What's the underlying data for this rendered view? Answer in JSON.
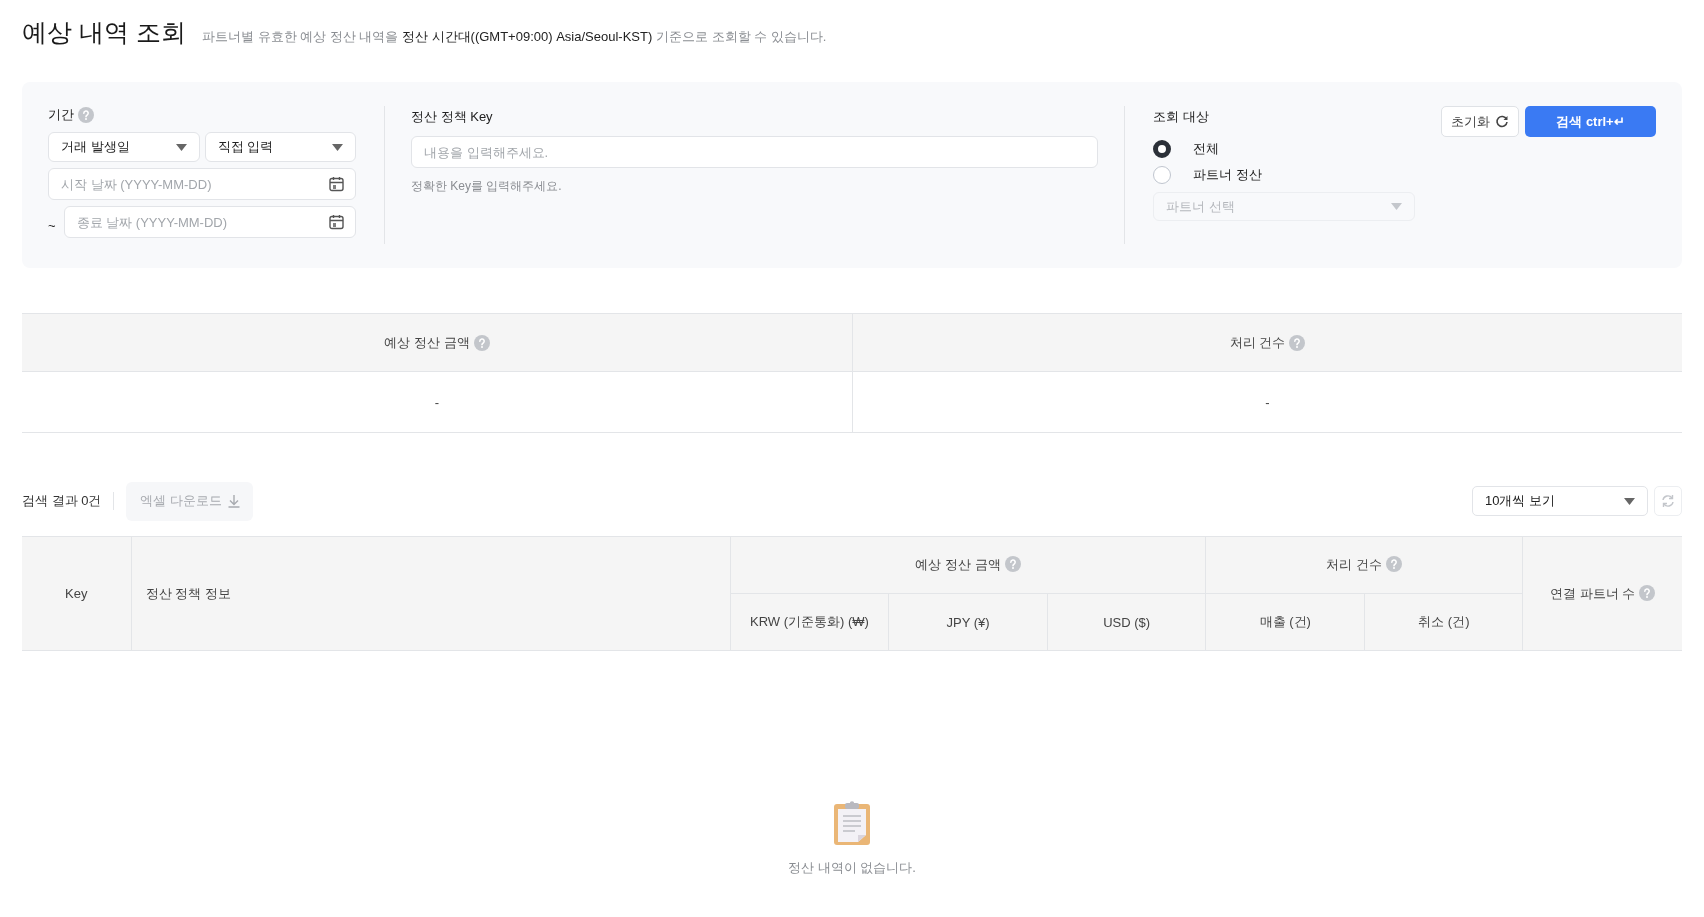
{
  "page": {
    "title": "예상 내역 조회",
    "description": "파트너별 유효한 예상 정산 내역을 **정산 시간대((GMT+09:00) Asia/Seoul-KST)** 기준으로 조회할 수 있습니다."
  },
  "filters": {
    "period": {
      "label": "기간",
      "date_type": "거래 발생일",
      "range_type": "직접 입력",
      "start": {
        "placeholder": "시작 날짜 (YYYY-MM-DD)"
      },
      "separator": "~",
      "end": {
        "placeholder": "종료 날짜 (YYYY-MM-DD)"
      }
    },
    "policy_key": {
      "label": "정산 정책 Key",
      "placeholder": "내용을 입력해주세요.",
      "hint": "정확한 Key를 입력해주세요."
    },
    "target": {
      "label": "조회 대상",
      "options": [
        {
          "label": "전체",
          "selected": true
        },
        {
          "label": "파트너 정산",
          "selected": false
        }
      ],
      "partner_select": {
        "placeholder": "파트너 선택",
        "disabled": true
      }
    },
    "buttons": [
      {
        "label": "초기화",
        "kind": "reset"
      },
      {
        "label": "검색 ctrl+↵",
        "kind": "primary"
      }
    ]
  },
  "summary": {
    "columns": [
      {
        "label": "예상 정산 금액",
        "help": true,
        "value": "-"
      },
      {
        "label": "처리 건수",
        "help": true,
        "value": "-"
      }
    ]
  },
  "results": {
    "count": "검색 결과 0건",
    "excel_button": {
      "label": "엑셀 다운로드",
      "disabled": true
    },
    "page_size": "10개씩 보기"
  },
  "table": {
    "columns": [
      {
        "label": "Key",
        "help": false
      },
      {
        "label": "정산 정책 정보",
        "help": false
      },
      {
        "label": "예상 정산 금액",
        "help": true,
        "children": [
          {
            "label": "KRW (기준통화) (₩)"
          },
          {
            "label": "JPY (¥)"
          },
          {
            "label": "USD ($)"
          }
        ]
      },
      {
        "label": "처리 건수",
        "help": true,
        "children": [
          {
            "label": "매출 (건)"
          },
          {
            "label": "취소 (건)"
          }
        ]
      },
      {
        "label": "연결 파트너 수",
        "help": true
      }
    ]
  },
  "empty": {
    "message": "정산 내역이 없습니다."
  }
}
